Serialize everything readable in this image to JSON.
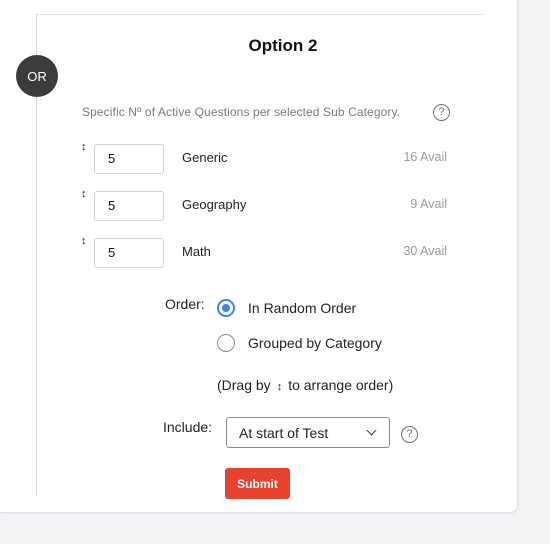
{
  "option": {
    "title": "Option 2",
    "or_label": "OR"
  },
  "description": "Specific Nº of Active Questions per selected Sub Category.",
  "help_icon_glyph": "?",
  "drag_glyph": "↕",
  "categories": [
    {
      "value": "5",
      "label": "Generic",
      "avail": "16 Avail"
    },
    {
      "value": "5",
      "label": "Geography",
      "avail": "9 Avail"
    },
    {
      "value": "5",
      "label": "Math",
      "avail": "30 Avail"
    }
  ],
  "order": {
    "label": "Order:",
    "options": [
      {
        "label": "In Random Order",
        "checked": true
      },
      {
        "label": "Grouped by Category",
        "checked": false
      }
    ],
    "drag_note_prefix": "(Drag by",
    "drag_note_suffix": "to arrange order)"
  },
  "include": {
    "label": "Include:",
    "selected": "At start of Test"
  },
  "submit_label": "Submit",
  "colors": {
    "accent": "#3b82f6",
    "submit": "#e8412c",
    "or_circle": "#3b3b3b"
  }
}
